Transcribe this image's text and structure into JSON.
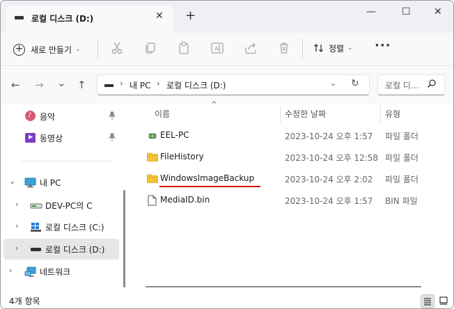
{
  "window": {
    "tab_title": "로컬 디스크 (D:)",
    "new_tab_glyph": "+",
    "close_tab_glyph": "✕",
    "minimize_glyph": "—",
    "maximize_glyph": "☐",
    "close_glyph": "✕"
  },
  "toolbar": {
    "new_label": "새로 만들기",
    "new_chevron": "⌄",
    "sort_label": "정렬",
    "sort_chevron": "⌄",
    "more_glyph": "···",
    "icons": [
      "cut-icon",
      "copy-icon",
      "paste-icon",
      "rename-icon",
      "share-icon",
      "delete-icon"
    ]
  },
  "nav": {
    "back_glyph": "←",
    "forward_glyph": "→",
    "recent_glyph": "⌄",
    "up_glyph": "↑",
    "breadcrumb": [
      "내 PC",
      "로컬 디스크 (D:)"
    ],
    "crumb_sep": "›",
    "dropdown_glyph": "⌄",
    "refresh_glyph": "↻",
    "search_placeholder": "로컬 디...",
    "search_glyph": "⚲"
  },
  "sidebar": {
    "items": [
      {
        "label": "음악",
        "icon": "music-icon",
        "pinned": true
      },
      {
        "label": "동영상",
        "icon": "video-icon",
        "pinned": true
      },
      {
        "label": "내 PC",
        "icon": "pc-icon",
        "expanded": true
      },
      {
        "label": "DEV-PC의 C",
        "icon": "network-drive-icon"
      },
      {
        "label": "로컬 디스크 (C:)",
        "icon": "windows-drive-icon"
      },
      {
        "label": "로컬 디스크 (D:)",
        "icon": "drive-icon",
        "selected": true
      },
      {
        "label": "네트워크",
        "icon": "network-icon"
      }
    ],
    "pin_glyph": "📌",
    "expand_glyph": "⌄",
    "collapse_glyph": "›"
  },
  "columns": {
    "name": "이름",
    "modified": "수정한 날짜",
    "type": "유형",
    "sort_glyph": "^"
  },
  "files": [
    {
      "name": "EEL-PC",
      "modified": "2023-10-24 오후 1:57",
      "type": "파일 폴더",
      "icon": "network-folder-icon"
    },
    {
      "name": "FileHistory",
      "modified": "2023-10-24 오후 12:58",
      "type": "파일 폴더",
      "icon": "folder-icon"
    },
    {
      "name": "WindowsImageBackup",
      "modified": "2023-10-24 오후 2:02",
      "type": "파일 폴더",
      "icon": "folder-icon",
      "highlighted": true
    },
    {
      "name": "MediaID.bin",
      "modified": "2023-10-24 오후 1:57",
      "type": "BIN 파일",
      "icon": "file-icon"
    }
  ],
  "status": {
    "count": "4개 항목"
  },
  "colors": {
    "folder": "#f5c33b",
    "highlight_underline": "#d40000",
    "selected_bg": "#e6e6e6"
  }
}
